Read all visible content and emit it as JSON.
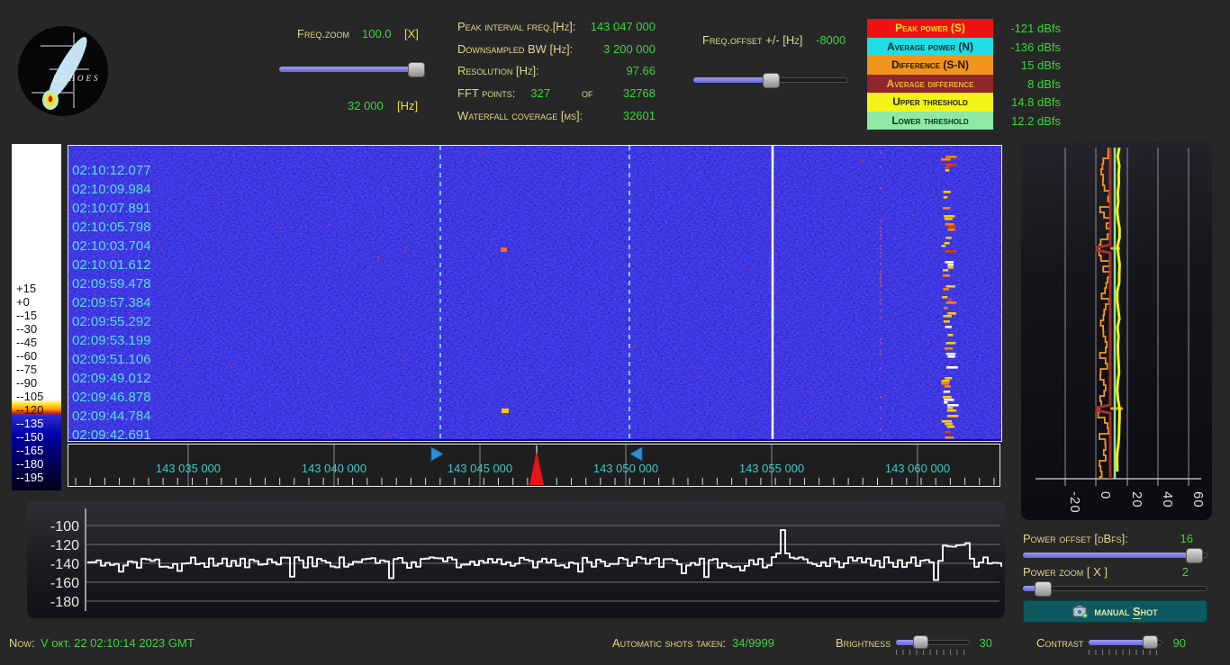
{
  "header": {
    "freq_zoom": {
      "label": "Freq.zoom",
      "value": "100.0",
      "unit_x": "[X]",
      "bw_value": "32 000",
      "unit_hz": "[Hz]"
    },
    "stats": [
      {
        "label": "Peak interval freq.[Hz]:",
        "value": "143 047 000"
      },
      {
        "label": "Downsampled BW  [Hz]:",
        "value": "3 200 000"
      },
      {
        "label": "Resolution [Hz]:",
        "value": "97.66"
      },
      {
        "label": "FFT points:",
        "value": "327",
        "of_word": "of",
        "total": "32768"
      },
      {
        "label": "Waterfall coverage [ms]:",
        "value": "32601"
      }
    ],
    "freq_offset": {
      "label": "Freq.offset +/- [Hz]",
      "value": "-8000"
    },
    "legend": [
      {
        "label": "Peak power (S)",
        "value": "-121 dBfs"
      },
      {
        "label": "Average power (N)",
        "value": "-136 dBfs"
      },
      {
        "label": "Difference (S-N)",
        "value": "15 dBfs"
      },
      {
        "label": "Average difference",
        "value": "8 dBfs"
      },
      {
        "label": "Upper threshold",
        "value": "14.8 dBfs"
      },
      {
        "label": "Lower threshold",
        "value": "12.2 dBfs"
      }
    ]
  },
  "colorbar": {
    "labels": [
      "+15",
      "+0",
      "--15",
      "--30",
      "--45",
      "--60",
      "--75",
      "--90",
      "--105",
      "--120",
      "--135",
      "--150",
      "--165",
      "--180",
      "--195"
    ]
  },
  "waterfall": {
    "timestamps": [
      "02:10:12.077",
      "02:10:09.984",
      "02:10:07.891",
      "02:10:05.798",
      "02:10:03.704",
      "02:10:01.612",
      "02:09:59.478",
      "02:09:57.384",
      "02:09:55.292",
      "02:09:53.199",
      "02:09:51.106",
      "02:09:49.012",
      "02:09:46.878",
      "02:09:44.784",
      "02:09:42.691"
    ]
  },
  "freq_ruler": {
    "ticks": [
      "143 035 000",
      "143 040 000",
      "143 045 000",
      "143 050 000",
      "143 055 000",
      "143 060 000"
    ]
  },
  "right_panel": {
    "axis_ticks": [
      "-20",
      "0",
      "20",
      "40",
      "60"
    ]
  },
  "bottom_spectrum": {
    "axis_ticks": [
      "-100",
      "-120",
      "-140",
      "-160",
      "-180"
    ]
  },
  "controls": {
    "power_offset": {
      "label": "Power offset [dBfs]:",
      "value": "16"
    },
    "power_zoom": {
      "label": "Power zoom  [ X ]",
      "value": "2"
    },
    "manual_shot": {
      "prefix": "manual ",
      "s": "S",
      "rest": "hot"
    }
  },
  "statusbar": {
    "now_label": "Now:",
    "now_value": "V окт. 22 02:10:14 2023 GMT",
    "shots_label": "Automatic shots taken:",
    "shots_value": "34/9999",
    "brightness_label": "Brightness",
    "brightness_value": "30",
    "contrast_label": "Contrast",
    "contrast_value": "90"
  },
  "colors": {
    "value_green": "#3bd43b",
    "label_khaki": "#d9d98e",
    "unit_yellow": "#e4e432",
    "legend_red": "#ee1212",
    "legend_cyan": "#22dce4",
    "legend_orange": "#f0941c",
    "legend_dark_red": "#8f262b",
    "legend_yellow": "#f4f414",
    "legend_light_green": "#8fe9a5",
    "waterfall_blue": "#1113cc",
    "timestamp_cyan": "#58dede",
    "freq_tick_cyan": "#3fc8c8",
    "slider_blue": "#7b7be4",
    "button_teal": "#0c5a60",
    "peak_marker_red": "#e81414"
  }
}
